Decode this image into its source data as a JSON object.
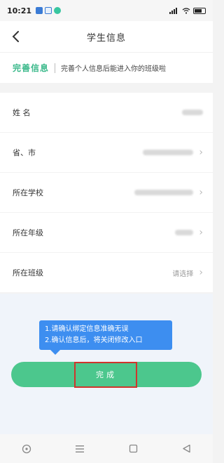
{
  "status": {
    "time": "10:21"
  },
  "header": {
    "title": "学生信息"
  },
  "banner": {
    "title": "完善信息",
    "subtitle": "完善个人信息后能进入你的班级啦"
  },
  "form": {
    "rows": [
      {
        "label": "姓 名",
        "value_redacted": true,
        "has_chevron": false
      },
      {
        "label": "省、市",
        "value_redacted": true,
        "has_chevron": true
      },
      {
        "label": "所在学校",
        "value_redacted": true,
        "has_chevron": true
      },
      {
        "label": "所在年级",
        "value_redacted": true,
        "has_chevron": true
      },
      {
        "label": "所在班级",
        "value": "请选择",
        "has_chevron": true
      }
    ]
  },
  "tooltip": {
    "line1": "1.请确认绑定信息准确无误",
    "line2": "2.确认信息后，将关闭修改入口"
  },
  "actions": {
    "done_label": "完成"
  },
  "colors": {
    "accent_green": "#4cc78d",
    "tooltip_blue": "#3d8ef0",
    "highlight_red": "#d0342c"
  }
}
